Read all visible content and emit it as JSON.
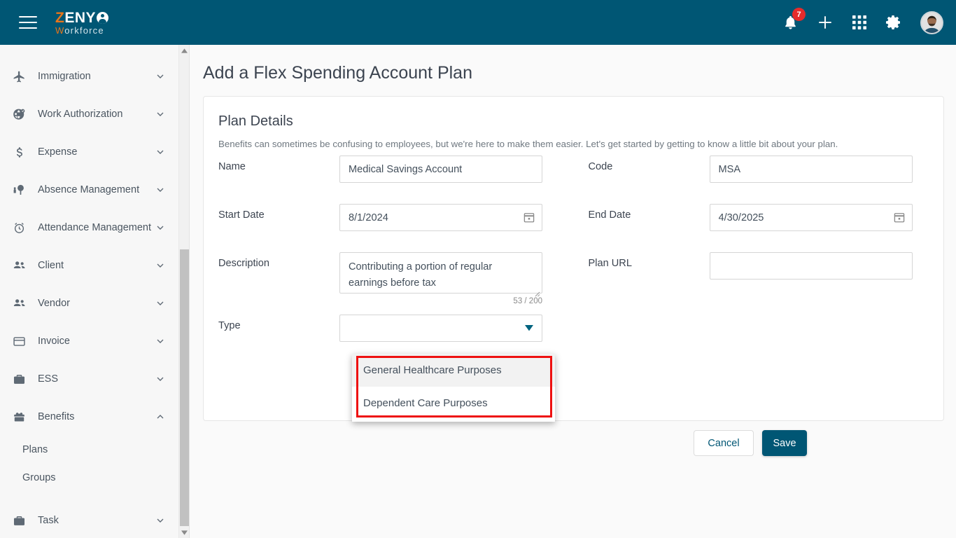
{
  "header": {
    "logo": {
      "part1": "Z",
      "part2": "ENY",
      "part3_w": "W",
      "part3_rest": "orkforce",
      "icon": "person-circle-icon"
    },
    "menu_icon": "hamburger-menu-icon",
    "notifications": {
      "icon": "bell-icon",
      "count": "7"
    },
    "add_icon": "plus-icon",
    "apps_icon": "grid-apps-icon",
    "settings_icon": "gear-icon",
    "avatar": "user-avatar"
  },
  "sidebar": {
    "items": [
      {
        "label": "Immigration",
        "icon": "airplane-icon",
        "chevron": "down"
      },
      {
        "label": "Work Authorization",
        "icon": "globe-check-icon",
        "chevron": "down"
      },
      {
        "label": "Expense",
        "icon": "dollar-icon",
        "chevron": "down"
      },
      {
        "label": "Absence Management",
        "icon": "person-tree-icon",
        "chevron": "down"
      },
      {
        "label": "Attendance Management",
        "icon": "alarm-clock-icon",
        "chevron": "down"
      },
      {
        "label": "Client",
        "icon": "people-icon",
        "chevron": "down"
      },
      {
        "label": "Vendor",
        "icon": "people-icon",
        "chevron": "down"
      },
      {
        "label": "Invoice",
        "icon": "card-icon",
        "chevron": "down"
      },
      {
        "label": "ESS",
        "icon": "briefcase-icon",
        "chevron": "down"
      },
      {
        "label": "Benefits",
        "icon": "benefits-box-icon",
        "chevron": "up"
      }
    ],
    "benefits_children": [
      {
        "label": "Plans"
      },
      {
        "label": "Groups"
      }
    ],
    "task_item": {
      "label": "Task",
      "icon": "briefcase-icon",
      "chevron": "down"
    }
  },
  "main": {
    "page_title": "Add a Flex Spending Account Plan",
    "back_button_icon": "arrow-left-icon",
    "card": {
      "title": "Plan Details",
      "subtitle": "Benefits can sometimes be confusing to employees, but we're here to make them easier. Let's get started by getting to know a little bit about your plan.",
      "fields": {
        "name": {
          "label": "Name",
          "value": "Medical Savings Account",
          "placeholder": ""
        },
        "code": {
          "label": "Code",
          "value": "MSA",
          "placeholder": ""
        },
        "start_date": {
          "label": "Start Date",
          "value": "8/1/2024",
          "icon": "calendar-icon"
        },
        "end_date": {
          "label": "End Date",
          "value": "4/30/2025",
          "icon": "calendar-icon"
        },
        "description": {
          "label": "Description",
          "value": "Contributing a portion of regular earnings before tax",
          "counter": "53 / 200"
        },
        "plan_url": {
          "label": "Plan URL",
          "value": "",
          "placeholder": ""
        },
        "type": {
          "label": "Type",
          "value": "",
          "arrow_icon": "chevron-down-icon"
        }
      },
      "buttons": {
        "cancel": "Cancel",
        "save": "Save"
      }
    },
    "type_dropdown": {
      "options": [
        {
          "label": "General Healthcare Purposes",
          "highlighted": true
        },
        {
          "label": "Dependent Care Purposes",
          "highlighted": false
        }
      ]
    }
  },
  "colors": {
    "brand": "#005674",
    "accent": "#e8751a",
    "badge": "#e62b2b",
    "annotation": "#ee1111",
    "content_bg": "#fafafa",
    "sidebar_bg": "#f7f7f7"
  }
}
